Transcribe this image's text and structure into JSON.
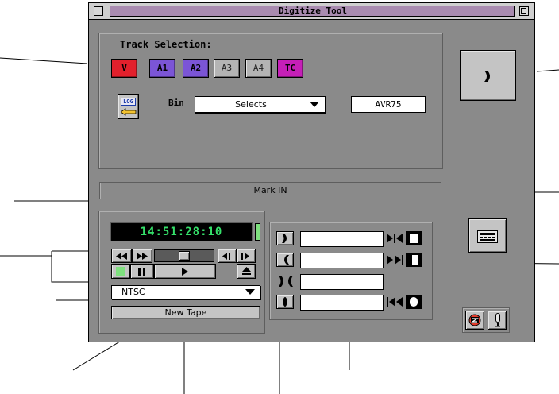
{
  "window": {
    "title": "Digitize Tool"
  },
  "tracks": {
    "label": "Track Selection:",
    "items": [
      {
        "label": "V",
        "color": "#e2202c",
        "selected": true
      },
      {
        "label": "A1",
        "color": "#7b55d6",
        "selected": true
      },
      {
        "label": "A2",
        "color": "#7b55d6",
        "selected": true
      },
      {
        "label": "A3",
        "color": "#b4b4b4",
        "selected": false
      },
      {
        "label": "A4",
        "color": "#b4b4b4",
        "selected": false
      },
      {
        "label": "TC",
        "color": "#c51fb7",
        "selected": true
      }
    ]
  },
  "log_button": {
    "label": "LOG"
  },
  "bin": {
    "label": "Bin",
    "value": "Selects"
  },
  "resolution": {
    "value": "AVR75"
  },
  "status": {
    "message": "Mark IN"
  },
  "timecode": {
    "value": "14:51:28:10"
  },
  "video_format": {
    "value": "NTSC"
  },
  "new_tape_button": {
    "label": "New Tape"
  },
  "colors": {
    "timecode_text": "#35e06a",
    "timecode_bg": "#000000",
    "record_led": "#7ee07e"
  }
}
